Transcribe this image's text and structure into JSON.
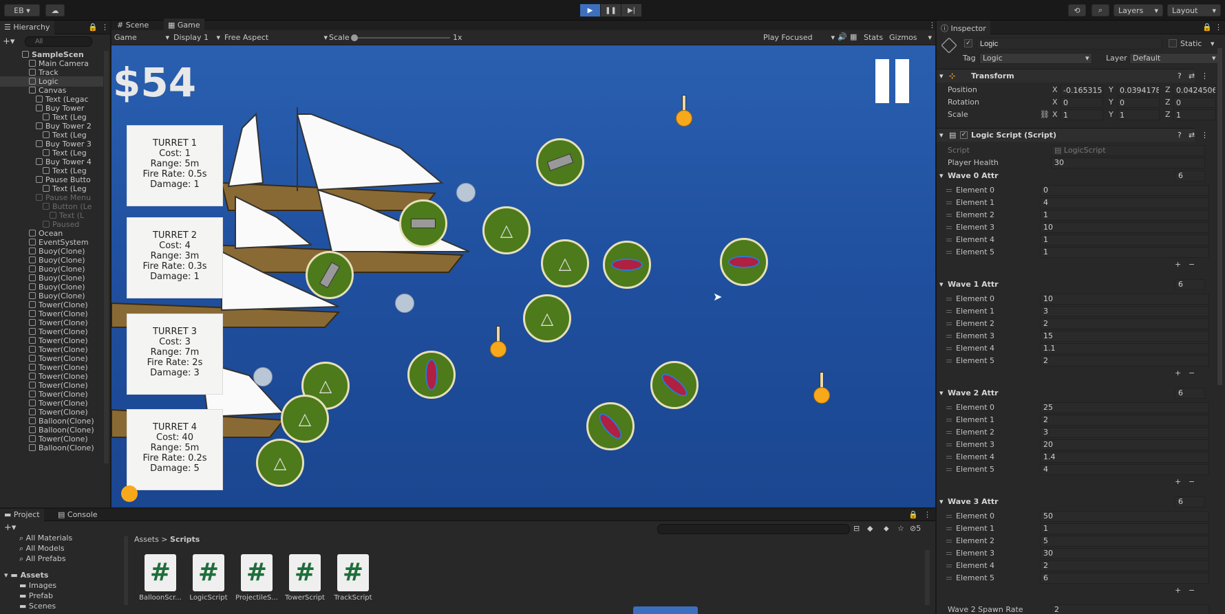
{
  "topbar": {
    "account": "EB",
    "layers": "Layers",
    "layout": "Layout"
  },
  "hierarchy": {
    "title": "Hierarchy",
    "search_placeholder": "All",
    "items": [
      {
        "label": "SampleScen",
        "indent": 0
      },
      {
        "label": "Main Camera",
        "indent": 1
      },
      {
        "label": "Track",
        "indent": 1
      },
      {
        "label": "Logic",
        "indent": 1
      },
      {
        "label": "Canvas",
        "indent": 1
      },
      {
        "label": "Text (Legac",
        "indent": 2
      },
      {
        "label": "Buy Tower",
        "indent": 2
      },
      {
        "label": "Text (Leg",
        "indent": 3
      },
      {
        "label": "Buy Tower 2",
        "indent": 2
      },
      {
        "label": "Text (Leg",
        "indent": 3
      },
      {
        "label": "Buy Tower 3",
        "indent": 2
      },
      {
        "label": "Text (Leg",
        "indent": 3
      },
      {
        "label": "Buy Tower 4",
        "indent": 2
      },
      {
        "label": "Text (Leg",
        "indent": 3
      },
      {
        "label": "Pause Butto",
        "indent": 2
      },
      {
        "label": "Text (Leg",
        "indent": 3
      },
      {
        "label": "Pause Menu",
        "indent": 2
      },
      {
        "label": "Button (Le",
        "indent": 3
      },
      {
        "label": "Text (L",
        "indent": 4
      },
      {
        "label": "Paused",
        "indent": 3
      },
      {
        "label": "Ocean",
        "indent": 1
      },
      {
        "label": "EventSystem",
        "indent": 1
      },
      {
        "label": "Buoy(Clone)",
        "indent": 1
      },
      {
        "label": "Buoy(Clone)",
        "indent": 1
      },
      {
        "label": "Buoy(Clone)",
        "indent": 1
      },
      {
        "label": "Buoy(Clone)",
        "indent": 1
      },
      {
        "label": "Buoy(Clone)",
        "indent": 1
      },
      {
        "label": "Buoy(Clone)",
        "indent": 1
      },
      {
        "label": "Tower(Clone)",
        "indent": 1
      },
      {
        "label": "Tower(Clone)",
        "indent": 1
      },
      {
        "label": "Tower(Clone)",
        "indent": 1
      },
      {
        "label": "Tower(Clone)",
        "indent": 1
      },
      {
        "label": "Tower(Clone)",
        "indent": 1
      },
      {
        "label": "Tower(Clone)",
        "indent": 1
      },
      {
        "label": "Tower(Clone)",
        "indent": 1
      },
      {
        "label": "Tower(Clone)",
        "indent": 1
      },
      {
        "label": "Tower(Clone)",
        "indent": 1
      },
      {
        "label": "Tower(Clone)",
        "indent": 1
      },
      {
        "label": "Tower(Clone)",
        "indent": 1
      },
      {
        "label": "Tower(Clone)",
        "indent": 1
      },
      {
        "label": "Tower(Clone)",
        "indent": 1
      },
      {
        "label": "Balloon(Clone)",
        "indent": 1
      },
      {
        "label": "Balloon(Clone)",
        "indent": 1
      },
      {
        "label": "Tower(Clone)",
        "indent": 1
      },
      {
        "label": "Balloon(Clone)",
        "indent": 1
      }
    ]
  },
  "view_tabs": {
    "scene": "Scene",
    "game": "Game"
  },
  "gamebar": {
    "mode": "Game",
    "display": "Display 1",
    "aspect": "Free Aspect",
    "scale_label": "Scale",
    "scale_value": "1x",
    "play_focused": "Play Focused",
    "stats": "Stats",
    "gizmos": "Gizmos"
  },
  "game": {
    "money": "$54",
    "turrets": [
      {
        "title": "TURRET 1",
        "cost": "Cost: 1",
        "range": "Range: 5m",
        "fire_rate": "Fire Rate: 0.5s",
        "damage": "Damage: 1"
      },
      {
        "title": "TURRET 2",
        "cost": "Cost: 4",
        "range": "Range: 3m",
        "fire_rate": "Fire Rate: 0.3s",
        "damage": "Damage: 1"
      },
      {
        "title": "TURRET 3",
        "cost": "Cost: 3",
        "range": "Range: 7m",
        "fire_rate": "Fire Rate: 2s",
        "damage": "Damage: 3"
      },
      {
        "title": "TURRET 4",
        "cost": "Cost: 40",
        "range": "Range: 5m",
        "fire_rate": "Fire Rate: 0.2s",
        "damage": "Damage: 5"
      }
    ]
  },
  "bottom": {
    "project_tab": "Project",
    "console_tab": "Console",
    "favorites": [
      "All Materials",
      "All Models",
      "All Prefabs"
    ],
    "assets_root": "Assets",
    "asset_folders": [
      "Images",
      "Prefab",
      "Scenes"
    ],
    "breadcrumb_root": "Assets",
    "breadcrumb_current": "Scripts",
    "scripts": [
      "BalloonScr...",
      "LogicScript",
      "ProjectileS...",
      "TowerScript",
      "TrackScript"
    ],
    "hidden_count": "5"
  },
  "inspector": {
    "title": "Inspector",
    "object_name": "Logic",
    "static_label": "Static",
    "tag_label": "Tag",
    "tag_value": "Logic",
    "layer_label": "Layer",
    "layer_value": "Default",
    "transform_title": "Transform",
    "position_label": "Position",
    "rotation_label": "Rotation",
    "scale_label": "Scale",
    "position": {
      "x": "-0.165315",
      "y": "0.0394178",
      "z": "0.0424506"
    },
    "rotation": {
      "x": "0",
      "y": "0",
      "z": "0"
    },
    "scale": {
      "x": "1",
      "y": "1",
      "z": "1"
    },
    "script_component_title": "Logic Script (Script)",
    "script_label": "Script",
    "script_value": "LogicScript",
    "player_health_label": "Player Health",
    "player_health": "30",
    "waves": [
      {
        "title": "Wave 0 Attr",
        "count": "6",
        "elements": [
          "0",
          "4",
          "1",
          "10",
          "1",
          "1"
        ]
      },
      {
        "title": "Wave 1 Attr",
        "count": "6",
        "elements": [
          "10",
          "3",
          "2",
          "15",
          "1.1",
          "2"
        ]
      },
      {
        "title": "Wave 2 Attr",
        "count": "6",
        "elements": [
          "25",
          "2",
          "3",
          "20",
          "1.4",
          "4"
        ]
      },
      {
        "title": "Wave 3 Attr",
        "count": "6",
        "elements": [
          "50",
          "1",
          "5",
          "30",
          "2",
          "6"
        ]
      }
    ],
    "element_labels": [
      "Element 0",
      "Element 1",
      "Element 2",
      "Element 3",
      "Element 4",
      "Element 5"
    ],
    "wave2_spawn_label": "Wave 2 Spawn Rate",
    "wave2_spawn_value": "2"
  }
}
